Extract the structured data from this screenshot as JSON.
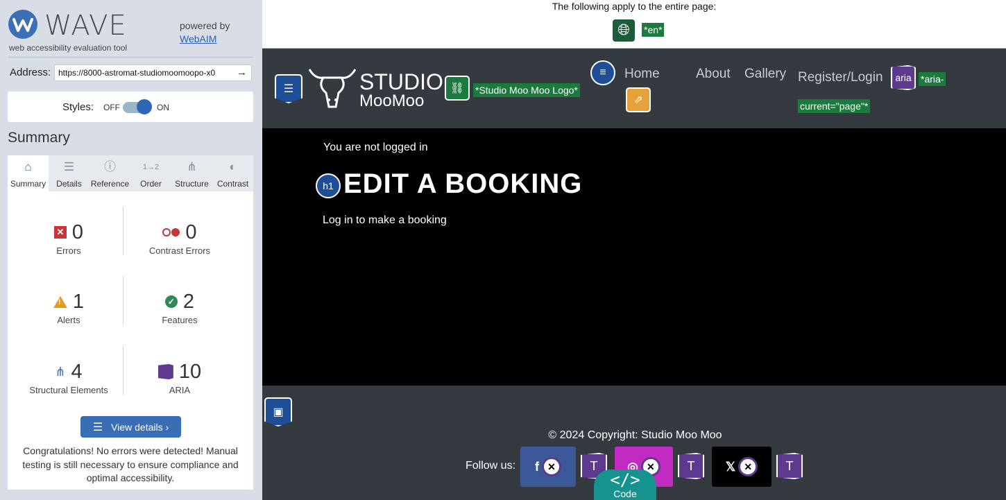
{
  "wave": {
    "logo_text": "WAVE",
    "tagline": "web accessibility evaluation tool",
    "powered_by": "powered by",
    "powered_link": "WebAIM",
    "address_label": "Address:",
    "address_value": "https://8000-astromat-studiomoomoopo-x0",
    "styles_label": "Styles:",
    "styles_off": "OFF",
    "styles_on": "ON",
    "styles_state": "on",
    "summary_heading": "Summary",
    "tabs": [
      {
        "label": "Summary",
        "icon": "home-icon",
        "active": true
      },
      {
        "label": "Details",
        "icon": "list-icon"
      },
      {
        "label": "Reference",
        "icon": "info-icon"
      },
      {
        "label": "Order",
        "icon": "order-icon"
      },
      {
        "label": "Structure",
        "icon": "structure-icon"
      },
      {
        "label": "Contrast",
        "icon": "contrast-icon"
      }
    ],
    "stats": {
      "errors": {
        "value": "0",
        "label": "Errors"
      },
      "contrast_errors": {
        "value": "0",
        "label": "Contrast Errors"
      },
      "alerts": {
        "value": "1",
        "label": "Alerts"
      },
      "features": {
        "value": "2",
        "label": "Features"
      },
      "structural": {
        "value": "4",
        "label": "Structural Elements"
      },
      "aria": {
        "value": "10",
        "label": "ARIA"
      }
    },
    "view_details": "View details ›",
    "congrats": "Congratulations! No errors were detected! Manual testing is still necessary to ensure compliance and optimal accessibility."
  },
  "page": {
    "apply_text": "The following apply to the entire page:",
    "lang_tag": "*en*",
    "logo_alt_tag": "*Studio Moo Moo Logo*",
    "brand_line1": "STUDIO",
    "brand_line2": "MooMoo",
    "nav": {
      "home": "Home",
      "about": "About",
      "gallery": "Gallery",
      "register": "Register/Login",
      "aria_badge": "aria",
      "aria_tag_line1": "*aria-",
      "aria_tag_line2": "current=\"page\"*"
    },
    "not_logged": "You are not logged in",
    "h1_badge": "h1",
    "heading": "EDIT A BOOKING",
    "login_msg": "Log in to make a booking",
    "copyright": "© 2024 Copyright: Studio Moo Moo",
    "follow": "Follow us:",
    "code_label": "Code",
    "colors": {
      "facebook": "#3b5998",
      "instagram": "#c22bc2",
      "x": "#000000",
      "accent": "#3a6eb4"
    }
  }
}
